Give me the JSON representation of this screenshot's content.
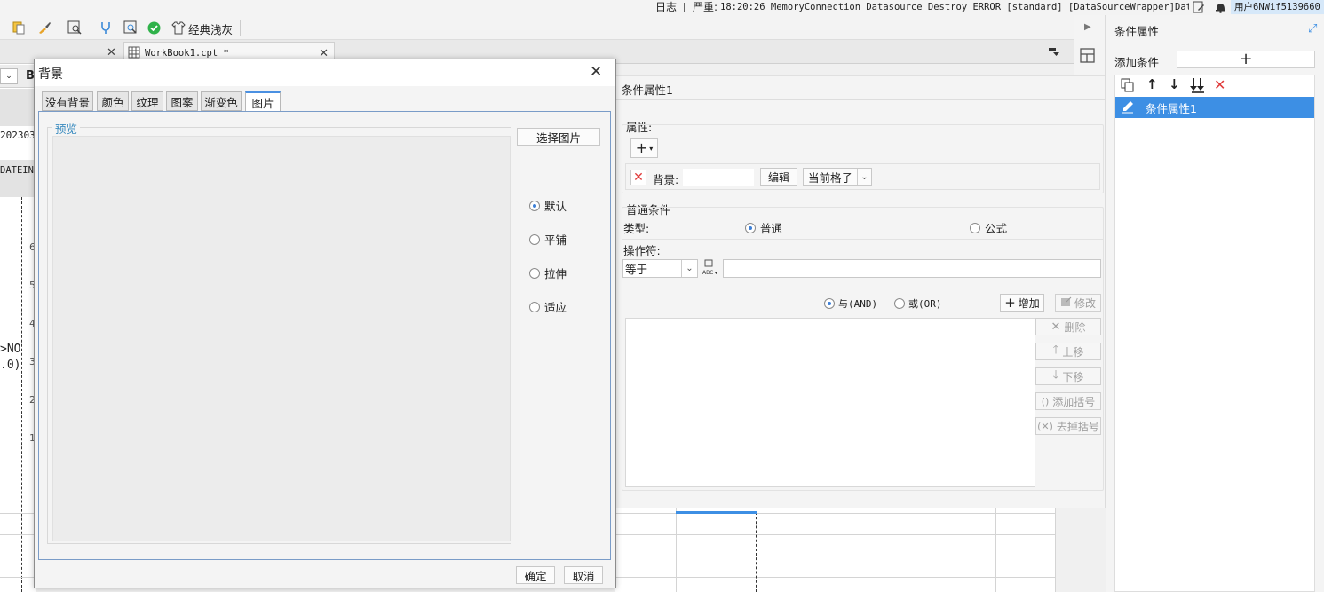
{
  "toolbar": {
    "theme_label": "经典浅灰"
  },
  "statusbar": {
    "log_label": "日志",
    "severity": "严重:",
    "message": "18:20:26 MemoryConnection_Datasource_Destroy ERROR [standard] [DataSourceWrapper]Data...",
    "user": "用户6NWif5139660"
  },
  "tabs": [
    {
      "label": "WorkBook1.cpt *"
    }
  ],
  "sheet": {
    "bold_label": "B",
    "cell_text_1": "202303",
    "cell_text_2": "DATEIN",
    "row_nums": [
      "6",
      "5",
      "4",
      "3",
      "2",
      "1"
    ],
    "frag_1": ">NO",
    "frag_2": ".0)"
  },
  "dialog": {
    "title": "背景",
    "tabs": [
      "没有背景",
      "颜色",
      "纹理",
      "图案",
      "渐变色",
      "图片"
    ],
    "active_tab": "图片",
    "preview_label": "预览",
    "select_image_button": "选择图片",
    "layout_options": [
      "默认",
      "平铺",
      "拉伸",
      "适应"
    ],
    "selected_option": "默认",
    "ok_button": "确定",
    "cancel_button": "取消"
  },
  "condition_panel": {
    "header": "条件属性1",
    "attributes_label": "属性:",
    "background_label": "背景:",
    "background_value": "",
    "edit_button": "编辑",
    "scope_select": "当前格子",
    "normal_condition_label": "普通条件",
    "type_label": "类型:",
    "type_options": [
      "普通",
      "公式"
    ],
    "operator_label": "操作符:",
    "operator_value": "等于",
    "operator_input": "",
    "and_label": "与(AND)",
    "or_label": "或(OR)",
    "add_button": "增加",
    "modify_button": "修改",
    "delete_button": "删除",
    "move_up_button": "上移",
    "move_down_button": "下移",
    "add_bracket_button": "添加括号",
    "remove_bracket_button": "去掉括号"
  },
  "right_panel": {
    "title": "条件属性",
    "add_condition_label": "添加条件",
    "items": [
      "条件属性1"
    ]
  },
  "colors": {
    "accent": "#3d8fe4",
    "selected_row": "#3d8fe4",
    "delete_red": "#e03a3a",
    "link_blue": "#3a8bbf"
  }
}
